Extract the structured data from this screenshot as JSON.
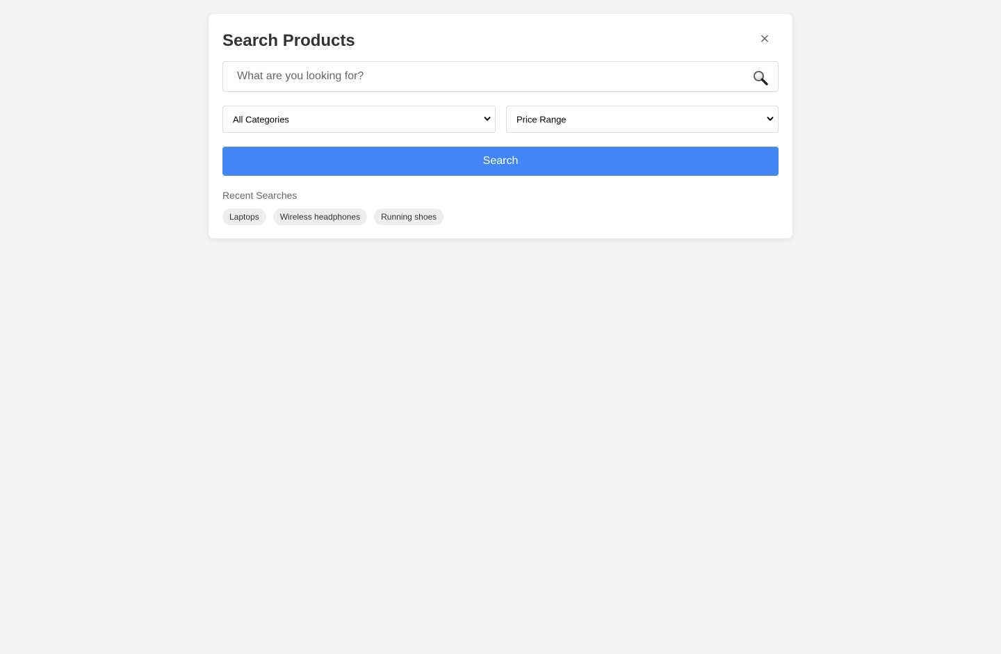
{
  "modal": {
    "title": "Search Products",
    "close_label": "×"
  },
  "search": {
    "placeholder": "What are you looking for?",
    "value": "",
    "icon": "magnifier-icon"
  },
  "filters": {
    "category": {
      "selected": "All Categories"
    },
    "price": {
      "selected": "Price Range"
    }
  },
  "actions": {
    "search_label": "Search"
  },
  "recent": {
    "title": "Recent Searches",
    "items": [
      {
        "label": "Laptops"
      },
      {
        "label": "Wireless headphones"
      },
      {
        "label": "Running shoes"
      }
    ]
  },
  "colors": {
    "accent": "#4285f4",
    "background": "#f4f4f4",
    "tag_background": "#eeeeee"
  }
}
